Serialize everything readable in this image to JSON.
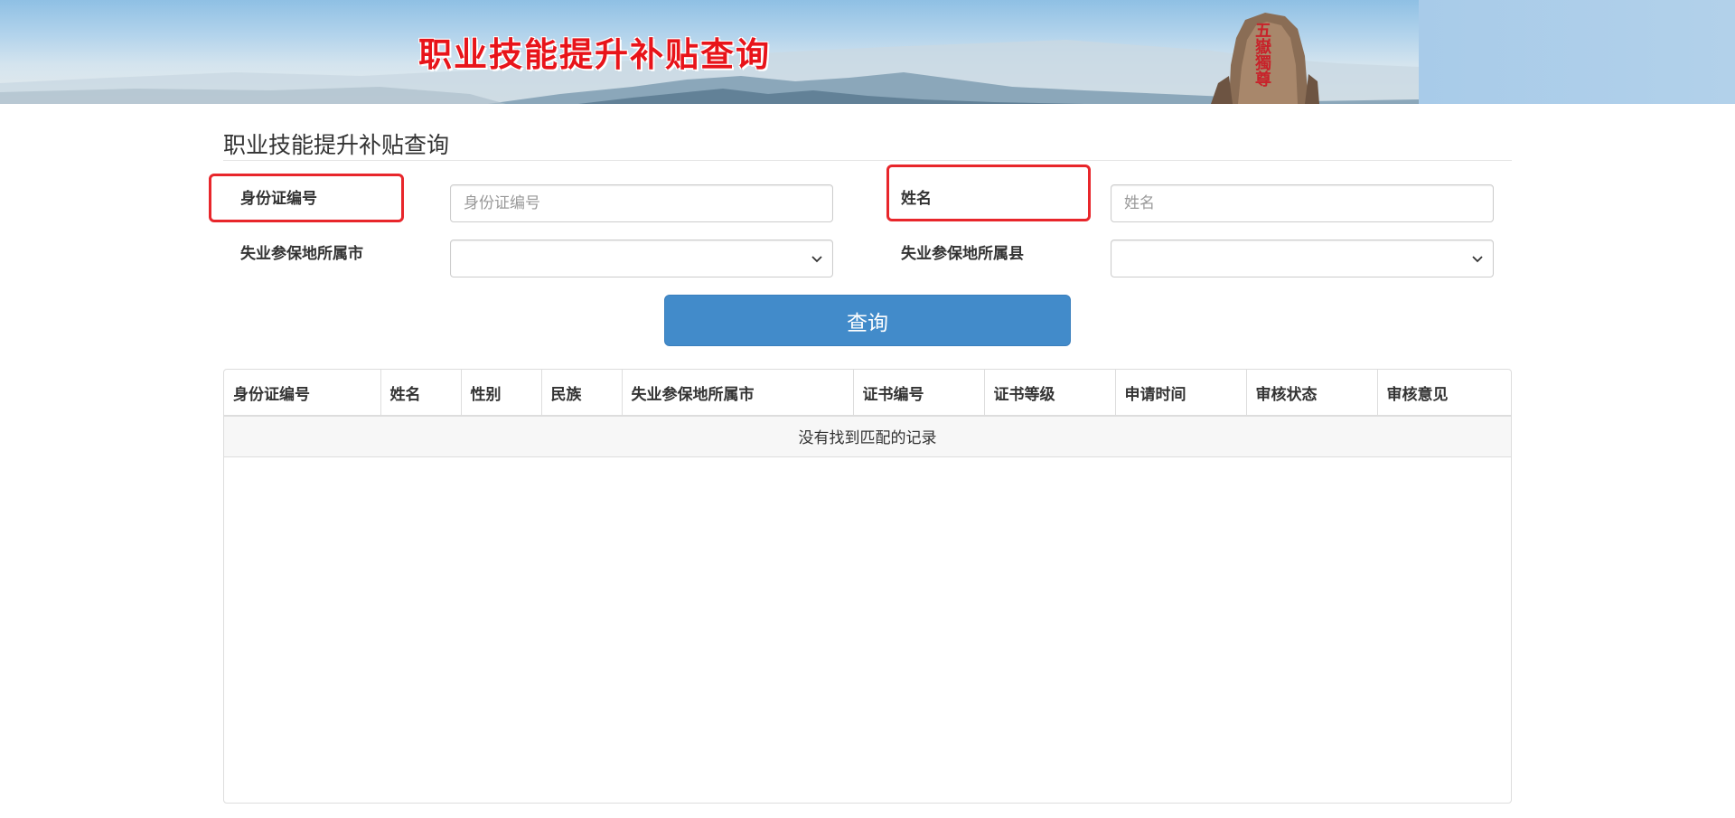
{
  "banner": {
    "title": "职业技能提升补贴查询",
    "rock_inscription": "五嶽獨尊"
  },
  "page": {
    "title": "职业技能提升补贴查询"
  },
  "form": {
    "id_label": "身份证编号",
    "id_placeholder": "身份证编号",
    "id_value": "",
    "name_label": "姓名",
    "name_placeholder": "姓名",
    "name_value": "",
    "city_label": "失业参保地所属市",
    "city_value": "",
    "county_label": "失业参保地所属县",
    "county_value": "",
    "query_label": "查询"
  },
  "table": {
    "columns": [
      "身份证编号",
      "姓名",
      "性别",
      "民族",
      "失业参保地所属市",
      "证书编号",
      "证书等级",
      "申请时间",
      "审核状态",
      "审核意见"
    ],
    "empty_text": "没有找到匹配的记录"
  },
  "colors": {
    "banner_title": "#e8141a",
    "highlight_box": "#e8262b",
    "primary_button": "#428bca"
  }
}
